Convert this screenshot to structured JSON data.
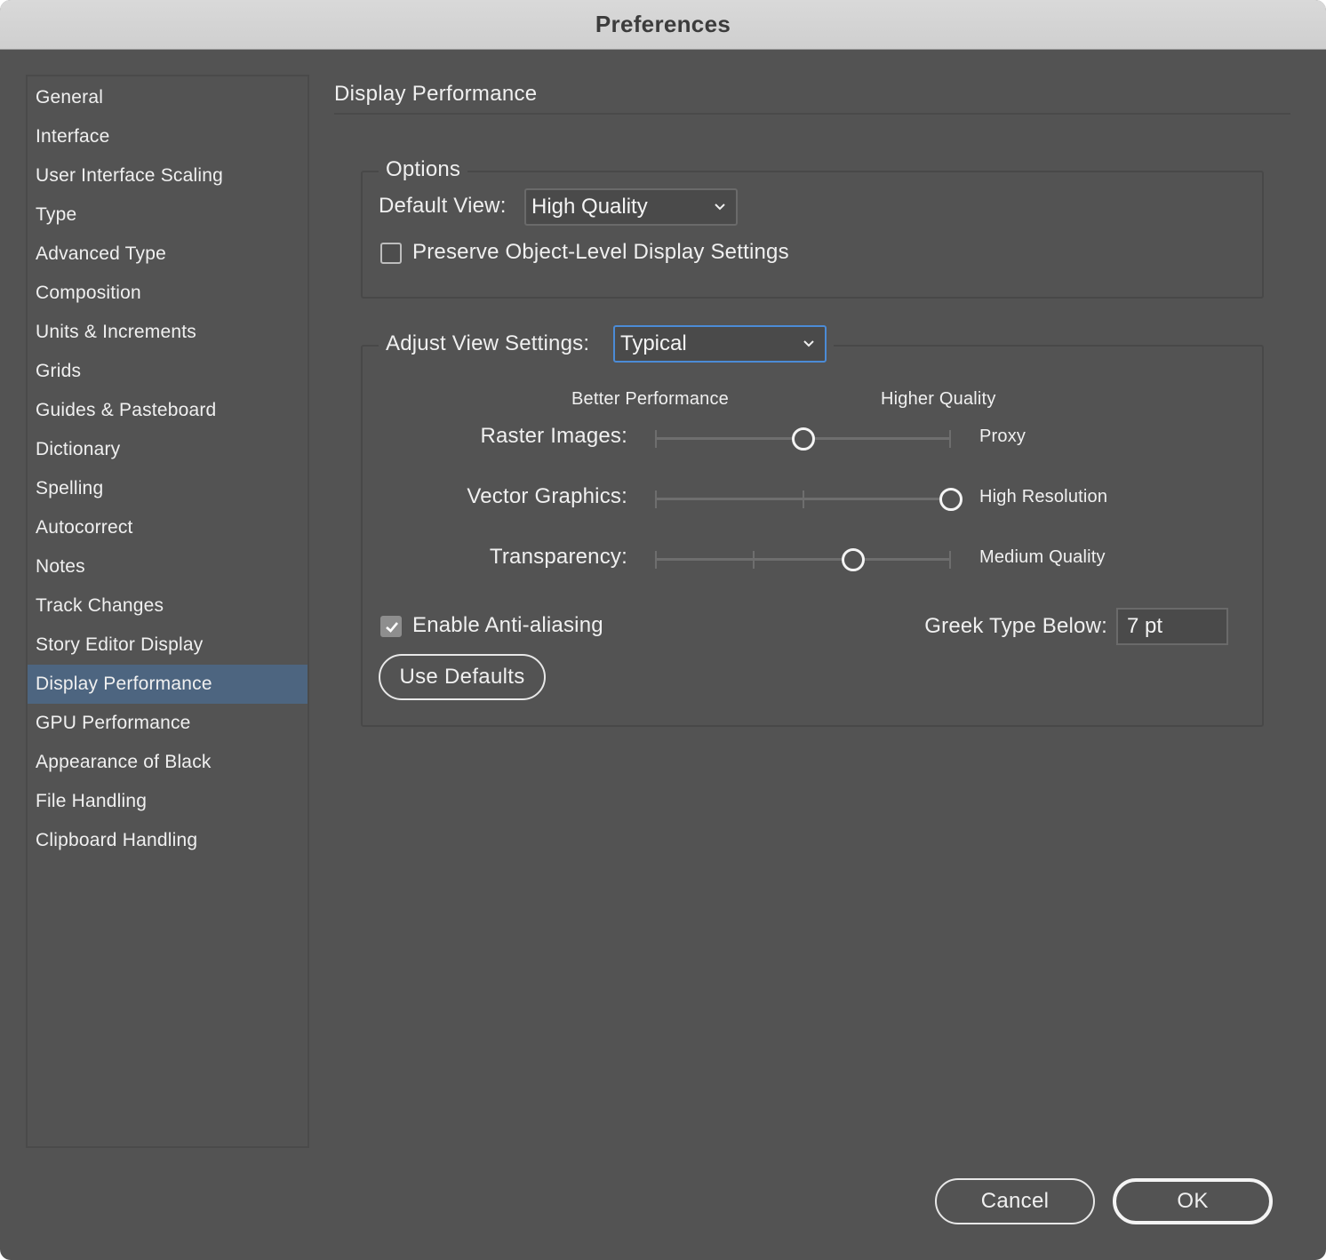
{
  "window": {
    "title": "Preferences"
  },
  "sidebar": {
    "items": [
      {
        "label": "General"
      },
      {
        "label": "Interface"
      },
      {
        "label": "User Interface Scaling"
      },
      {
        "label": "Type"
      },
      {
        "label": "Advanced Type"
      },
      {
        "label": "Composition"
      },
      {
        "label": "Units & Increments"
      },
      {
        "label": "Grids"
      },
      {
        "label": "Guides & Pasteboard"
      },
      {
        "label": "Dictionary"
      },
      {
        "label": "Spelling"
      },
      {
        "label": "Autocorrect"
      },
      {
        "label": "Notes"
      },
      {
        "label": "Track Changes"
      },
      {
        "label": "Story Editor Display"
      },
      {
        "label": "Display Performance"
      },
      {
        "label": "GPU Performance"
      },
      {
        "label": "Appearance of Black"
      },
      {
        "label": "File Handling"
      },
      {
        "label": "Clipboard Handling"
      }
    ],
    "selected": "Display Performance"
  },
  "main": {
    "page_title": "Display Performance",
    "options": {
      "legend": "Options",
      "default_view_label": "Default View:",
      "default_view_value": "High Quality",
      "preserve_label": "Preserve Object-Level Display Settings",
      "preserve_checked": false
    },
    "adjust": {
      "legend_label": "Adjust View Settings:",
      "legend_value": "Typical",
      "scale_left": "Better Performance",
      "scale_right": "Higher Quality",
      "sliders": [
        {
          "label": "Raster Images:",
          "value_label": "Proxy",
          "position": 0.5
        },
        {
          "label": "Vector Graphics:",
          "value_label": "High Resolution",
          "position": 1.0
        },
        {
          "label": "Transparency:",
          "value_label": "Medium Quality",
          "position": 0.67
        }
      ],
      "antialias_label": "Enable Anti-aliasing",
      "antialias_checked": true,
      "greek_label": "Greek Type Below:",
      "greek_value": "7 pt",
      "use_defaults_label": "Use Defaults"
    }
  },
  "footer": {
    "cancel_label": "Cancel",
    "ok_label": "OK"
  },
  "colors": {
    "panel": "#535353",
    "selection": "#4d6580",
    "focus": "#4b8bd6"
  }
}
